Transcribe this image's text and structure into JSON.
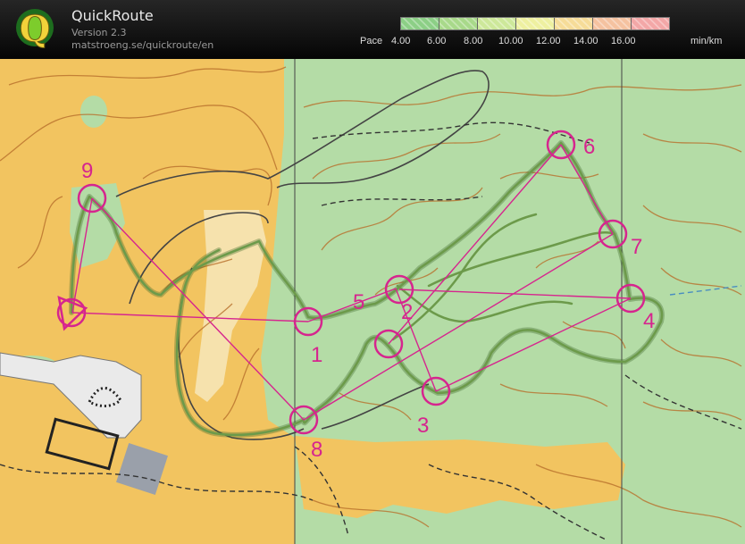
{
  "app": {
    "title": "QuickRoute",
    "version": "Version 2.3",
    "url": "matstroeng.se/quickroute/en"
  },
  "pace_legend": {
    "label": "Pace",
    "ticks": [
      "4.00",
      "6.00",
      "8.00",
      "10.00",
      "12.00",
      "14.00",
      "16.00"
    ],
    "unit": "min/km",
    "colors": [
      "#8ccf86",
      "#a8d98a",
      "#cde89a",
      "#eef0a0",
      "#f6dc98",
      "#f5c2a0",
      "#f3a7a7"
    ]
  },
  "map": {
    "colors": {
      "open_land": "#f2c460",
      "forest": "#b4dca6",
      "contour": "#b8702c",
      "course": "#d6258e",
      "route": "#5d8a40",
      "track": "#444444"
    }
  },
  "controls": [
    {
      "label": "1"
    },
    {
      "label": "2"
    },
    {
      "label": "3"
    },
    {
      "label": "4"
    },
    {
      "label": "5"
    },
    {
      "label": "6"
    },
    {
      "label": "7"
    },
    {
      "label": "8"
    },
    {
      "label": "9"
    }
  ]
}
